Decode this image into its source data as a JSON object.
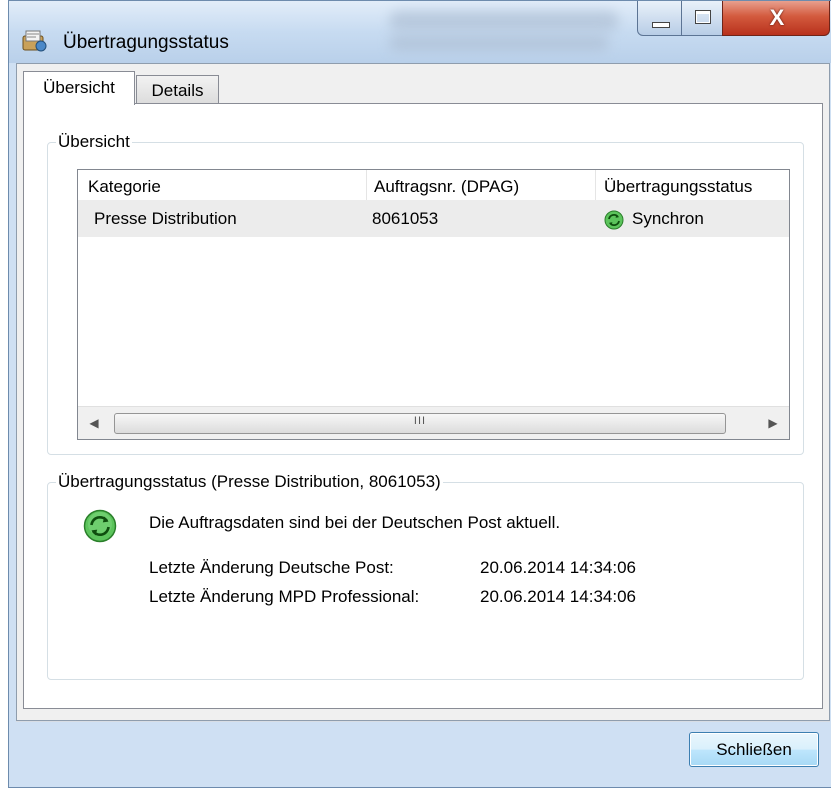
{
  "window": {
    "title": "Übertragungsstatus"
  },
  "tabs": [
    {
      "label": "Übersicht",
      "active": true
    },
    {
      "label": "Details",
      "active": false
    }
  ],
  "overview_group": {
    "label": "Übersicht",
    "columns": [
      "Kategorie",
      "Auftragsnr. (DPAG)",
      "Übertragungsstatus"
    ],
    "rows": [
      {
        "kategorie": "Presse Distribution",
        "auftragsnr": "8061053",
        "status": "Synchron",
        "status_icon": "sync-icon"
      }
    ],
    "scrollbar_grip": "III"
  },
  "status_group": {
    "label": "Übertragungsstatus (Presse Distribution, 8061053)",
    "message": "Die Auftragsdaten sind bei der Deutschen Post aktuell.",
    "status_icon": "sync-icon",
    "details": [
      {
        "label": "Letzte Änderung Deutsche Post:",
        "value": "20.06.2014 14:34:06"
      },
      {
        "label": "Letzte Änderung MPD Professional:",
        "value": "20.06.2014 14:34:06"
      }
    ]
  },
  "footer": {
    "close_label": "Schließen"
  },
  "colors": {
    "sync_green": "#3fb13f",
    "close_red": "#c7432a",
    "accent_blue": "#3c7fb1"
  }
}
